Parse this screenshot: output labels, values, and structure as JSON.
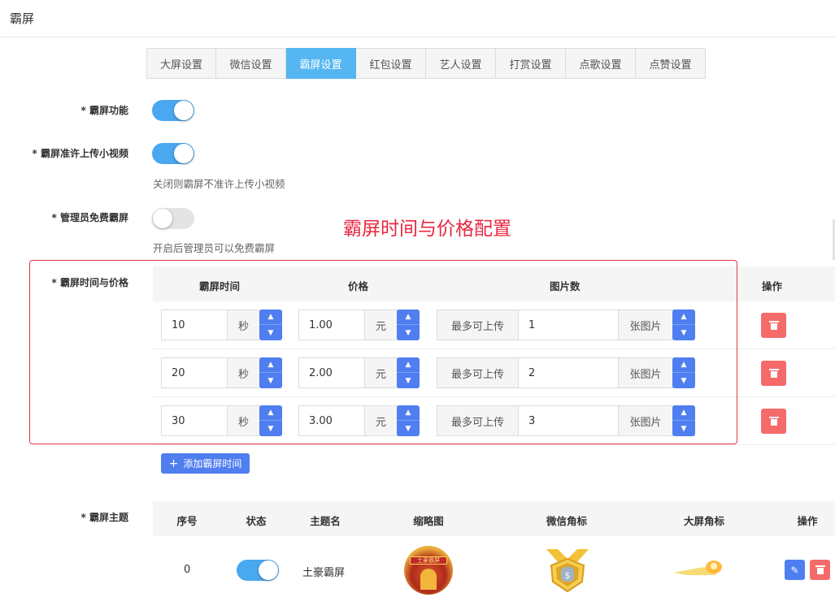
{
  "header": {
    "title": "霸屏"
  },
  "tabs": [
    {
      "label": "大屏设置",
      "active": false
    },
    {
      "label": "微信设置",
      "active": false
    },
    {
      "label": "霸屏设置",
      "active": true
    },
    {
      "label": "红包设置",
      "active": false
    },
    {
      "label": "艺人设置",
      "active": false
    },
    {
      "label": "打赏设置",
      "active": false
    },
    {
      "label": "点歌设置",
      "active": false
    },
    {
      "label": "点赞设置",
      "active": false
    }
  ],
  "form": {
    "feature": {
      "label": "* 霸屏功能",
      "enabled": true
    },
    "allow_video": {
      "label": "* 霸屏准许上传小视频",
      "enabled": true,
      "help": "关闭则霸屏不准许上传小视频"
    },
    "admin_free": {
      "label": "* 管理员免费霸屏",
      "enabled": false,
      "help": "开启后管理员可以免费霸屏"
    },
    "time_price": {
      "label": "* 霸屏时间与价格"
    },
    "theme": {
      "label": "* 霸屏主题"
    }
  },
  "annotation": {
    "text": "霸屏时间与价格配置",
    "color": "#e8283f"
  },
  "price_table": {
    "headers": {
      "time": "霸屏时间",
      "price": "价格",
      "images": "图片数",
      "ops": "操作"
    },
    "unit_seconds": "秒",
    "unit_currency": "元",
    "images_prefix": "最多可上传",
    "images_suffix": "张图片",
    "rows": [
      {
        "time": "10",
        "price": "1.00",
        "images": "1"
      },
      {
        "time": "20",
        "price": "2.00",
        "images": "2"
      },
      {
        "time": "30",
        "price": "3.00",
        "images": "3"
      }
    ],
    "add_button": "添加霸屏时间"
  },
  "theme_table": {
    "headers": {
      "index": "序号",
      "status": "状态",
      "name": "主题名",
      "thumbnail": "缩略图",
      "wechat_badge": "微信角标",
      "screen_badge": "大屏角标",
      "ops": "操作"
    },
    "rows": [
      {
        "index": "0",
        "status": true,
        "name": "土豪霸屏",
        "thumb_text": "土豪霸屏"
      }
    ]
  },
  "colors": {
    "accent": "#4f7ef0",
    "tab_active": "#55b6f2",
    "switch_on": "#4aa8f0",
    "danger": "#f56a6a"
  }
}
